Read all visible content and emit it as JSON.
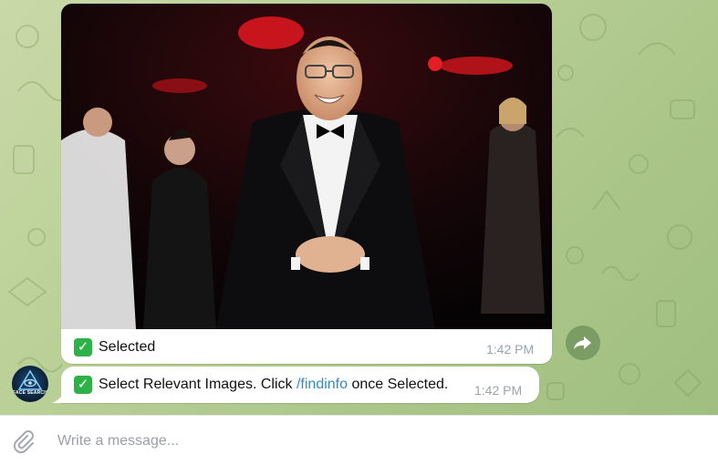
{
  "messages": [
    {
      "kind": "photo",
      "caption": "Selected",
      "time": "1:42 PM",
      "photo_icon": "photo-of-man-in-tuxedo-at-event"
    },
    {
      "kind": "text",
      "text_before": "Select Relevant Images. Click ",
      "link": "/findinfo",
      "text_after": " once Selected.",
      "time": "1:42 PM"
    }
  ],
  "sender": {
    "avatar_label": "FACE SEARCH",
    "avatar_icon": "eye-pyramid-icon"
  },
  "composer": {
    "placeholder": "Write a message..."
  },
  "icons": {
    "check": "check-mark-button-emoji",
    "forward": "forward-arrow-icon",
    "attach": "paperclip-icon"
  },
  "colors": {
    "wallpaper": "#b8cf95",
    "bubble": "#ffffff",
    "link": "#2a8cd0",
    "time": "#9aa3a9",
    "check": "#2fb14a"
  }
}
